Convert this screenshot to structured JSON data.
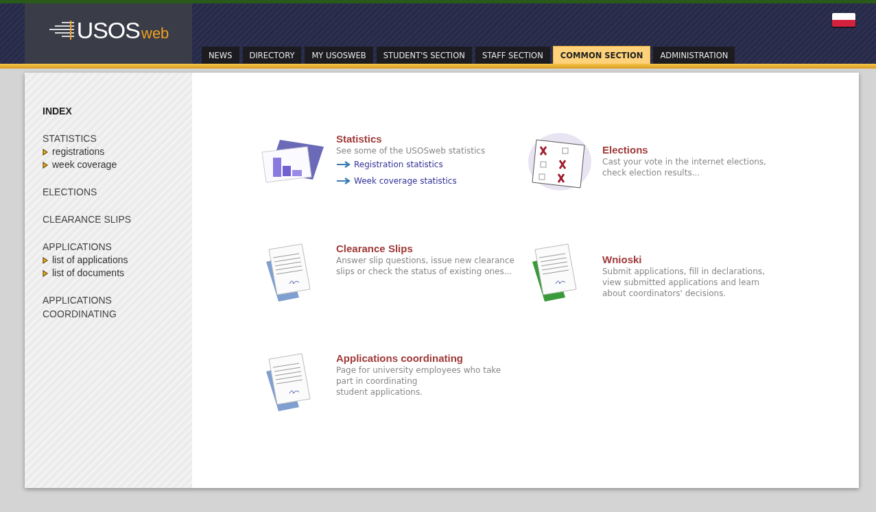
{
  "header": {
    "logo": {
      "text": "USOS",
      "suffix": "web"
    },
    "tabs": [
      {
        "label": "NEWS",
        "selected": false
      },
      {
        "label": "DIRECTORY",
        "selected": false
      },
      {
        "label": "MY USOSWEB",
        "selected": false
      },
      {
        "label": "STUDENT'S SECTION",
        "selected": false
      },
      {
        "label": "STAFF SECTION",
        "selected": false
      },
      {
        "label": "COMMON SECTION",
        "selected": true
      },
      {
        "label": "ADMINISTRATION",
        "selected": false
      }
    ]
  },
  "sidebar": {
    "sections": [
      {
        "title": "INDEX",
        "selected": true
      },
      {
        "title": "STATISTICS",
        "selected": false,
        "children": [
          {
            "label": "registrations"
          },
          {
            "label": "week coverage"
          }
        ]
      },
      {
        "title": "ELECTIONS",
        "selected": false
      },
      {
        "title": "CLEARANCE SLIPS",
        "selected": false
      },
      {
        "title": "APPLICATIONS",
        "selected": false,
        "children": [
          {
            "label": "list of applications"
          },
          {
            "label": "list of documents"
          }
        ]
      },
      {
        "title": "APPLICATIONS COORDINATING",
        "selected": false
      }
    ]
  },
  "tiles": [
    {
      "kind": "chart",
      "title": "Statistics",
      "description": [
        "See some of the USOSweb statistics"
      ],
      "links": [
        "Registration statistics",
        "Week coverage statistics"
      ]
    },
    {
      "kind": "ballot",
      "title": "Elections",
      "description": [
        "Cast your vote in the internet elections,",
        "check election results..."
      ]
    },
    {
      "kind": "document",
      "color": "#7f9fd0",
      "title": "Clearance Slips",
      "description": [
        "Answer slip questions, issue new clearance",
        "slips or check the status of existing ones..."
      ]
    },
    {
      "kind": "document",
      "color": "#3a9a3a",
      "title": "Wnioski",
      "description": [
        "Submit applications, fill in declarations,",
        "view submitted applications and learn",
        "about coordinators' decisions."
      ]
    },
    {
      "kind": "document",
      "color": "#7f9fd0",
      "title": "Applications coordinating",
      "description": [
        "Page for university employees who take",
        "part in coordinating",
        "student applications."
      ]
    }
  ]
}
